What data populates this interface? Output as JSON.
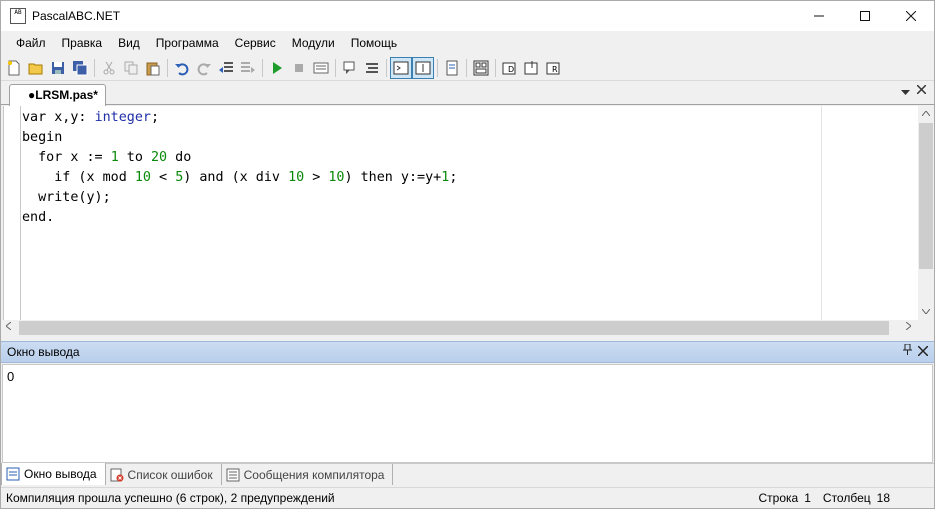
{
  "window": {
    "title": "PascalABC.NET",
    "icon_text": "AB"
  },
  "menu": [
    "Файл",
    "Правка",
    "Вид",
    "Программа",
    "Сервис",
    "Модули",
    "Помощь"
  ],
  "tabs": {
    "active_file": "●LRSM.pas*"
  },
  "editor": {
    "lines": [
      [
        {
          "t": "var x,y: "
        },
        {
          "t": "integer",
          "c": "ty"
        },
        {
          "t": ";"
        }
      ],
      [
        {
          "t": "begin"
        }
      ],
      [
        {
          "t": "  for x := "
        },
        {
          "t": "1",
          "c": "num"
        },
        {
          "t": " to "
        },
        {
          "t": "20",
          "c": "num"
        },
        {
          "t": " do"
        }
      ],
      [
        {
          "t": "    if (x mod "
        },
        {
          "t": "10",
          "c": "num"
        },
        {
          "t": " < "
        },
        {
          "t": "5",
          "c": "num"
        },
        {
          "t": ") and (x div "
        },
        {
          "t": "10",
          "c": "num"
        },
        {
          "t": " > "
        },
        {
          "t": "10",
          "c": "num"
        },
        {
          "t": ") then y:=y+"
        },
        {
          "t": "1",
          "c": "num"
        },
        {
          "t": ";"
        }
      ],
      [
        {
          "t": "  write(y);"
        }
      ],
      [
        {
          "t": "end."
        }
      ]
    ]
  },
  "output": {
    "header": "Окно вывода",
    "text": "0"
  },
  "bottom_tabs": {
    "output": "Окно вывода",
    "errors": "Список ошибок",
    "compiler": "Сообщения компилятора"
  },
  "status": {
    "message": "Компиляция прошла успешно (6 строк), 2 предупреждений",
    "row_label": "Строка",
    "row_value": "1",
    "col_label": "Столбец",
    "col_value": "18"
  },
  "colors": {
    "type_keyword": "#1f2fa8",
    "number_literal": "#0a8a0a",
    "output_header": "#c3d6ef"
  }
}
